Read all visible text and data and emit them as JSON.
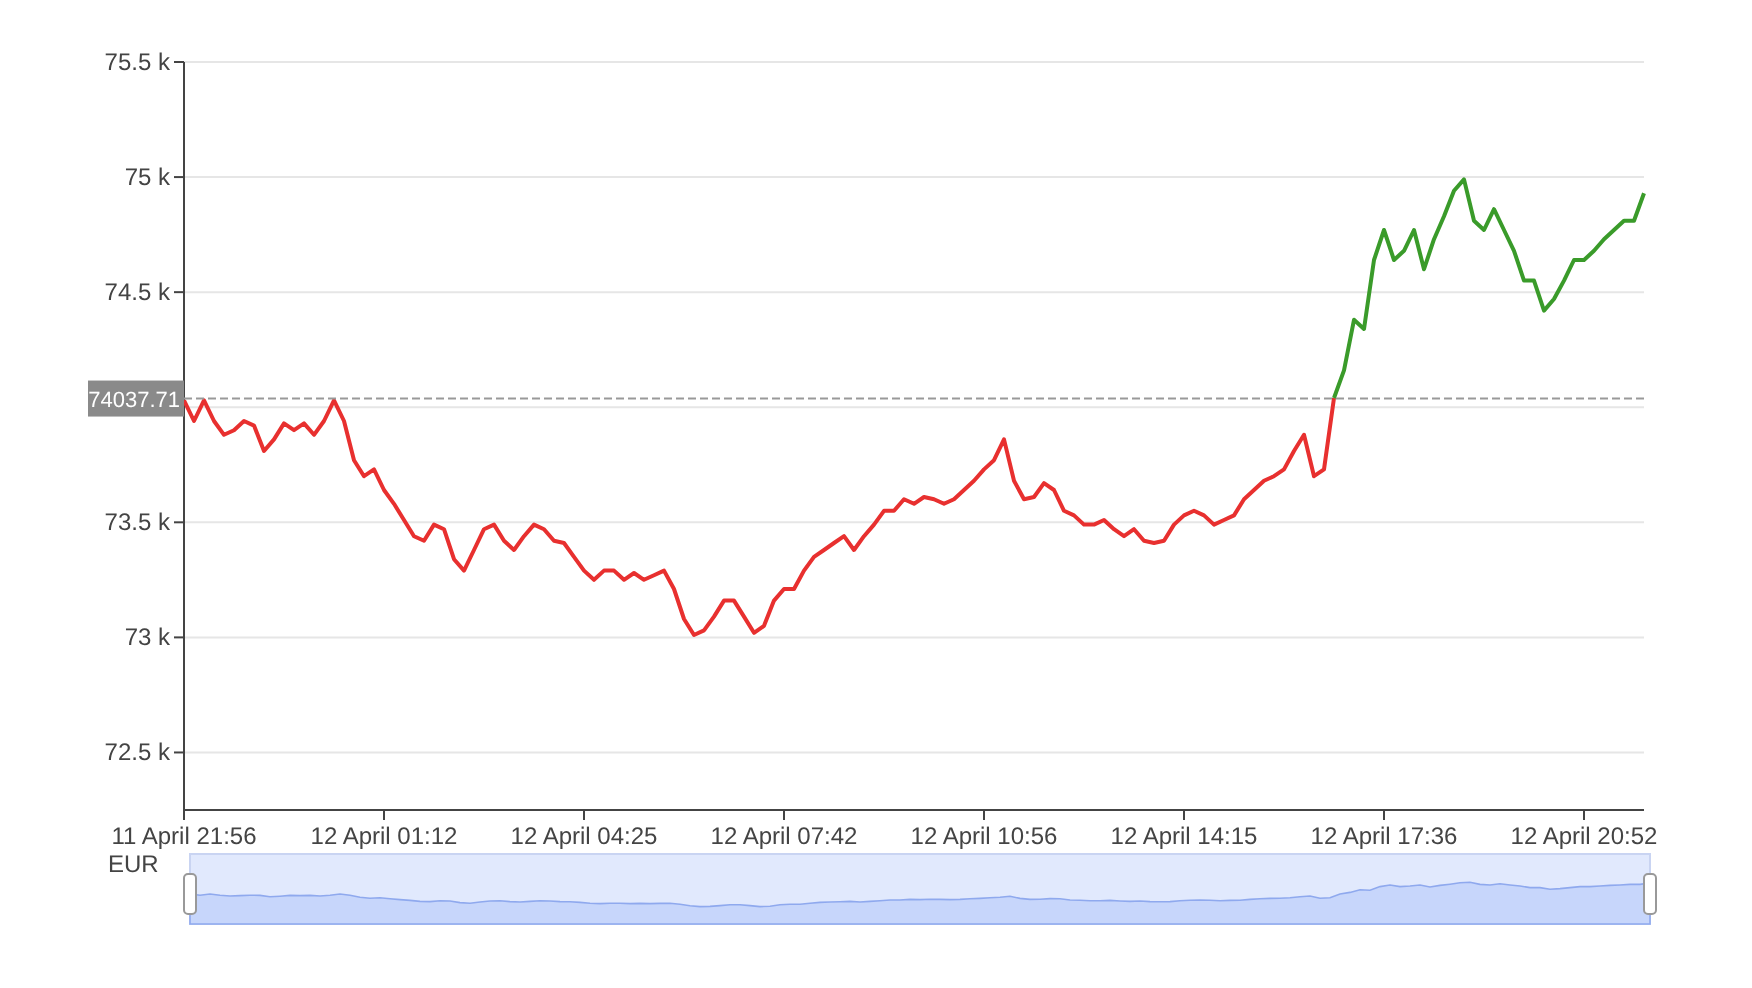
{
  "chart": {
    "chart_data": {
      "type": "line",
      "grid": true,
      "ylim": [
        72250,
        75500
      ],
      "yticks": [
        {
          "value": 72500,
          "label": "72.5 k"
        },
        {
          "value": 73000,
          "label": "73 k"
        },
        {
          "value": 73500,
          "label": "73.5 k"
        },
        {
          "value": 74500,
          "label": "74.5 k"
        },
        {
          "value": 75000,
          "label": "75 k"
        },
        {
          "value": 75500,
          "label": "75.5 k"
        }
      ],
      "categories": [
        "11 April 21:56",
        null,
        null,
        null,
        null,
        null,
        null,
        null,
        null,
        null,
        null,
        null,
        null,
        null,
        null,
        null,
        null,
        null,
        null,
        null,
        "12 April 01:12",
        null,
        null,
        null,
        null,
        null,
        null,
        null,
        null,
        null,
        null,
        null,
        null,
        null,
        null,
        null,
        null,
        null,
        null,
        null,
        "12 April 04:25",
        null,
        null,
        null,
        null,
        null,
        null,
        null,
        null,
        null,
        null,
        null,
        null,
        null,
        null,
        null,
        null,
        null,
        null,
        null,
        "12 April 07:42",
        null,
        null,
        null,
        null,
        null,
        null,
        null,
        null,
        null,
        null,
        null,
        null,
        null,
        null,
        null,
        null,
        null,
        null,
        null,
        "12 April 10:56",
        null,
        null,
        null,
        null,
        null,
        null,
        null,
        null,
        null,
        null,
        null,
        null,
        null,
        null,
        null,
        null,
        null,
        null,
        null,
        "12 April 14:15",
        null,
        null,
        null,
        null,
        null,
        null,
        null,
        null,
        null,
        null,
        null,
        null,
        null,
        null,
        null,
        null,
        null,
        null,
        null,
        "12 April 17:36",
        null,
        null,
        null,
        null,
        null,
        null,
        null,
        null,
        null,
        null,
        null,
        null,
        null,
        null,
        null,
        null,
        null,
        null,
        null,
        "12 April 20:52",
        null,
        null,
        null,
        null,
        null,
        null
      ],
      "series": [
        {
          "color": "#e8302f",
          "values": [
            74030,
            73940,
            74030,
            73940,
            73880,
            73900,
            73940,
            73920,
            73810,
            73860,
            73930,
            73900,
            73930,
            73880,
            73940,
            74030,
            73940,
            73770,
            73700,
            73730,
            73640,
            73580,
            73510,
            73440,
            73420,
            73490,
            73470,
            73340,
            73290,
            73380,
            73470,
            73490,
            73420,
            73380,
            73440,
            73490,
            73470,
            73420,
            73410,
            73350,
            73290,
            73250,
            73290,
            73290,
            73250,
            73280,
            73250,
            73270,
            73290,
            73210,
            73080,
            73010,
            73030,
            73090,
            73160,
            73160,
            73090,
            73020,
            73050,
            73160,
            73210,
            73210,
            73290,
            73350,
            73380,
            73410,
            73440,
            73380,
            73440,
            73490,
            73550,
            73550,
            73600,
            73580,
            73610,
            73600,
            73580,
            73600,
            73640,
            73680,
            73730,
            73770,
            73860,
            73680,
            73600,
            73610,
            73670,
            73640,
            73550,
            73530,
            73490,
            73490,
            73510,
            73470,
            73440,
            73470,
            73420,
            73410,
            73420,
            73490,
            73530,
            73550,
            73530,
            73490,
            73510,
            73530,
            73600,
            73640,
            73680,
            73700,
            73730,
            73810,
            73880,
            73700,
            73730,
            74040,
            null,
            null,
            null,
            null,
            null,
            null,
            null,
            null,
            null,
            null,
            null,
            null,
            null,
            null,
            null,
            null,
            null,
            null,
            null,
            null,
            null,
            null,
            null,
            null,
            null,
            null,
            null,
            null,
            null,
            null,
            null
          ]
        },
        {
          "color": "#3a9b2a",
          "values": [
            null,
            null,
            null,
            null,
            null,
            null,
            null,
            null,
            null,
            null,
            null,
            null,
            null,
            null,
            null,
            null,
            null,
            null,
            null,
            null,
            null,
            null,
            null,
            null,
            null,
            null,
            null,
            null,
            null,
            null,
            null,
            null,
            null,
            null,
            null,
            null,
            null,
            null,
            null,
            null,
            null,
            null,
            null,
            null,
            null,
            null,
            null,
            null,
            null,
            null,
            null,
            null,
            null,
            null,
            null,
            null,
            null,
            null,
            null,
            null,
            null,
            null,
            null,
            null,
            null,
            null,
            null,
            null,
            null,
            null,
            null,
            null,
            null,
            null,
            null,
            null,
            null,
            null,
            null,
            null,
            null,
            null,
            null,
            null,
            null,
            null,
            null,
            null,
            null,
            null,
            null,
            null,
            null,
            null,
            null,
            null,
            null,
            null,
            null,
            null,
            null,
            null,
            null,
            null,
            null,
            null,
            null,
            null,
            null,
            null,
            null,
            null,
            null,
            null,
            null,
            74040,
            74160,
            74380,
            74340,
            74640,
            74770,
            74640,
            74680,
            74770,
            74600,
            74730,
            74830,
            74940,
            74990,
            74810,
            74770,
            74860,
            74770,
            74680,
            74550,
            74550,
            74420,
            74470,
            74550,
            74640,
            74640,
            74680,
            74730,
            74770,
            74810,
            74810,
            74930
          ]
        }
      ],
      "ref_lines": [
        {
          "axis": "y",
          "value": 74037.71,
          "label": "74037.71"
        }
      ]
    }
  },
  "navigator": {
    "label": "EUR"
  }
}
